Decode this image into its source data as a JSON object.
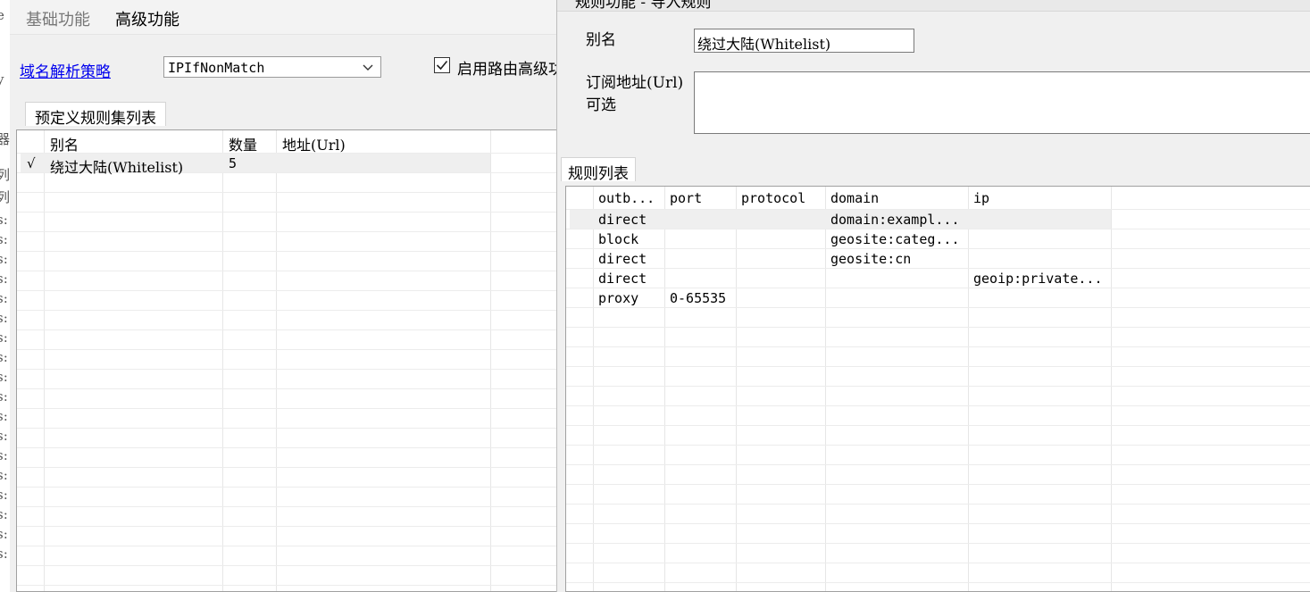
{
  "edge": {
    "chars": [
      "e",
      "y",
      "器",
      "列",
      "列",
      "s:",
      "s:",
      "s:",
      "s:",
      "s:",
      "s:",
      "s:",
      "s:",
      "s:",
      "s:",
      "s:",
      "s:",
      "s:",
      "s:",
      "s:",
      "s:",
      "s:",
      "s:"
    ]
  },
  "top_tabs": {
    "basic": "基础功能",
    "advanced": "高级功能"
  },
  "dns_strategy": {
    "label": "域名解析策略",
    "value": "IPIfNonMatch"
  },
  "advanced_routing": {
    "checked": true,
    "label": "启用路由高级功"
  },
  "ruleset_tab": "预定义规则集列表",
  "ruleset_table": {
    "columns": [
      "别名",
      "数量",
      "地址(Url)"
    ],
    "rows": [
      {
        "check": "√",
        "alias": "绕过大陆(Whitelist)",
        "count": "5",
        "url": ""
      }
    ]
  },
  "dialog": {
    "title_fragment": "规则功能 - 导入规则",
    "alias_label": "别名",
    "alias_value": "绕过大陆(Whitelist)",
    "url_label_line1": "订阅地址(Url)",
    "url_label_line2": "可选",
    "url_value": "",
    "rules_tab": "规则列表",
    "rules_table": {
      "columns": [
        "outb...",
        "port",
        "protocol",
        "domain",
        "ip"
      ],
      "rows": [
        [
          "direct",
          "",
          "",
          "domain:exampl...",
          ""
        ],
        [
          "block",
          "",
          "",
          "geosite:categ...",
          ""
        ],
        [
          "direct",
          "",
          "",
          "geosite:cn",
          ""
        ],
        [
          "direct",
          "",
          "",
          "",
          "geoip:private..."
        ],
        [
          "proxy",
          "0-65535",
          "",
          "",
          ""
        ]
      ]
    }
  }
}
